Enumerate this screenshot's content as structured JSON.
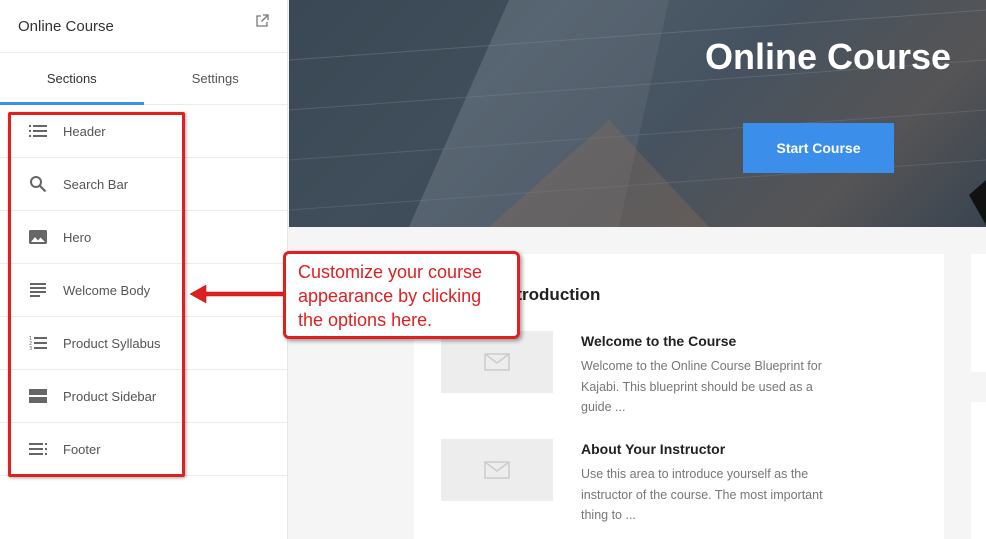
{
  "sidebar": {
    "title": "Online Course",
    "tabs": [
      {
        "label": "Sections",
        "active": true
      },
      {
        "label": "Settings",
        "active": false
      }
    ],
    "sections": [
      {
        "label": "Header",
        "icon": "list-icon"
      },
      {
        "label": "Search Bar",
        "icon": "search-icon"
      },
      {
        "label": "Hero",
        "icon": "image-icon"
      },
      {
        "label": "Welcome Body",
        "icon": "text-lines-icon"
      },
      {
        "label": "Product Syllabus",
        "icon": "numbered-list-icon"
      },
      {
        "label": "Product Sidebar",
        "icon": "split-panel-icon"
      },
      {
        "label": "Footer",
        "icon": "footer-lines-icon"
      }
    ]
  },
  "hero": {
    "title": "Online Course",
    "button_label": "Start Course"
  },
  "course": {
    "section_title": "ntroduction",
    "lessons": [
      {
        "title": "Welcome to the Course",
        "description": "Welcome to the Online Course Blueprint for Kajabi. This blueprint should be used as a guide ..."
      },
      {
        "title": "About Your Instructor",
        "description": "Use this area to introduce yourself as the instructor of the course. The most important thing to ..."
      }
    ]
  },
  "callout": {
    "text": "Customize your course appearance by clicking the options here."
  },
  "colors": {
    "accent": "#3b8eea",
    "annotation": "#e02020"
  }
}
